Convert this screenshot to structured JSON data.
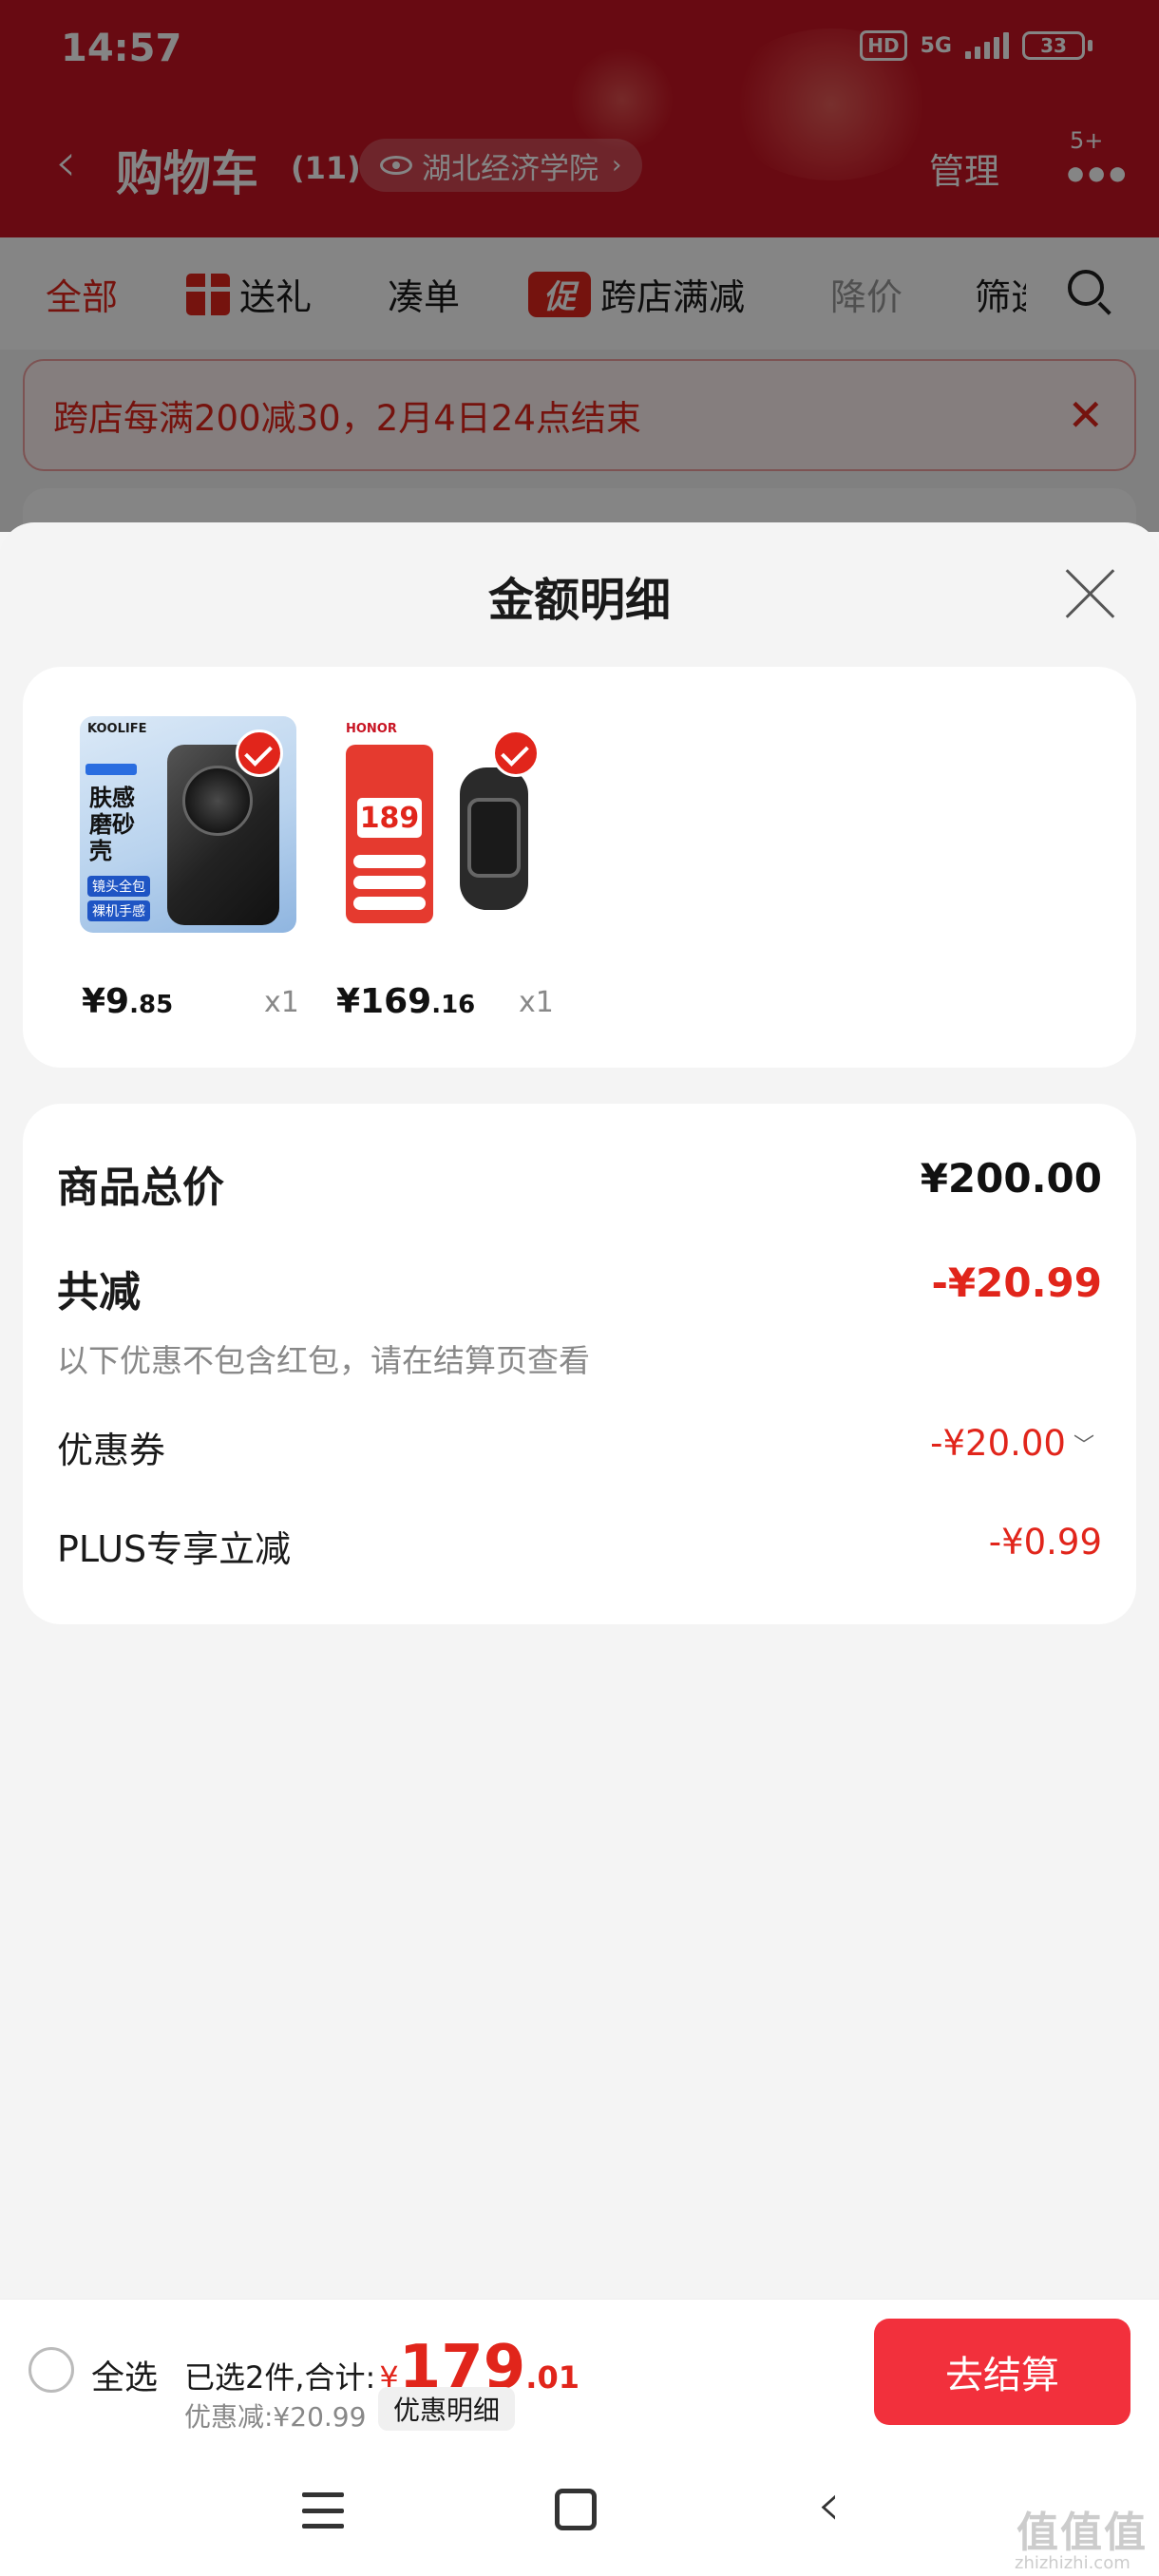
{
  "status_bar": {
    "time": "14:57",
    "hd": "HD",
    "network": "5G",
    "battery": "33"
  },
  "nav": {
    "title": "购物车",
    "count": "(11)",
    "location": "湖北经济学院",
    "manage": "管理",
    "more_badge": "5+"
  },
  "tabs": [
    {
      "label": "全部"
    },
    {
      "label": "送礼"
    },
    {
      "label": "凑单"
    },
    {
      "label": "跨店满减"
    },
    {
      "label": "降价"
    },
    {
      "label": "筛选"
    }
  ],
  "promo_icon_text": "促",
  "promo_banner": "跨店每满200减30，2月4日24点结束",
  "sheet": {
    "title": "金额明细",
    "products": [
      {
        "brand": "KOOLIFE",
        "headline": "肤感磨砂壳",
        "chips": [
          "镜头全包",
          "裸机手感"
        ],
        "price_int": "¥9",
        "price_dec": ".85",
        "qty": "x1"
      },
      {
        "brand": "HONOR",
        "big_price": "189",
        "price_int": "¥169",
        "price_dec": ".16",
        "qty": "x1"
      }
    ],
    "summary": {
      "total_label": "商品总价",
      "total_value": "¥200.00",
      "discount_label": "共减",
      "discount_value": "-¥20.99",
      "note": "以下优惠不包含红包，请在结算页查看",
      "coupon_label": "优惠券",
      "coupon_value": "-¥20.00",
      "plus_label": "PLUS专享立减",
      "plus_value": "-¥0.99"
    }
  },
  "checkout": {
    "select_all": "全选",
    "selected_text": "已选2件,合计:",
    "currency": "¥",
    "amount_int": "179",
    "amount_dec": ".01",
    "discount_note": "优惠减:¥20.99",
    "detail_button": "优惠明细",
    "checkout_button": "去结算"
  },
  "watermark": {
    "text": "值值值",
    "url": "zhizhizhi.com"
  },
  "colors": {
    "brand_red": "#e1251b",
    "header_red": "#c81423",
    "checkout_red": "#f2303c"
  }
}
